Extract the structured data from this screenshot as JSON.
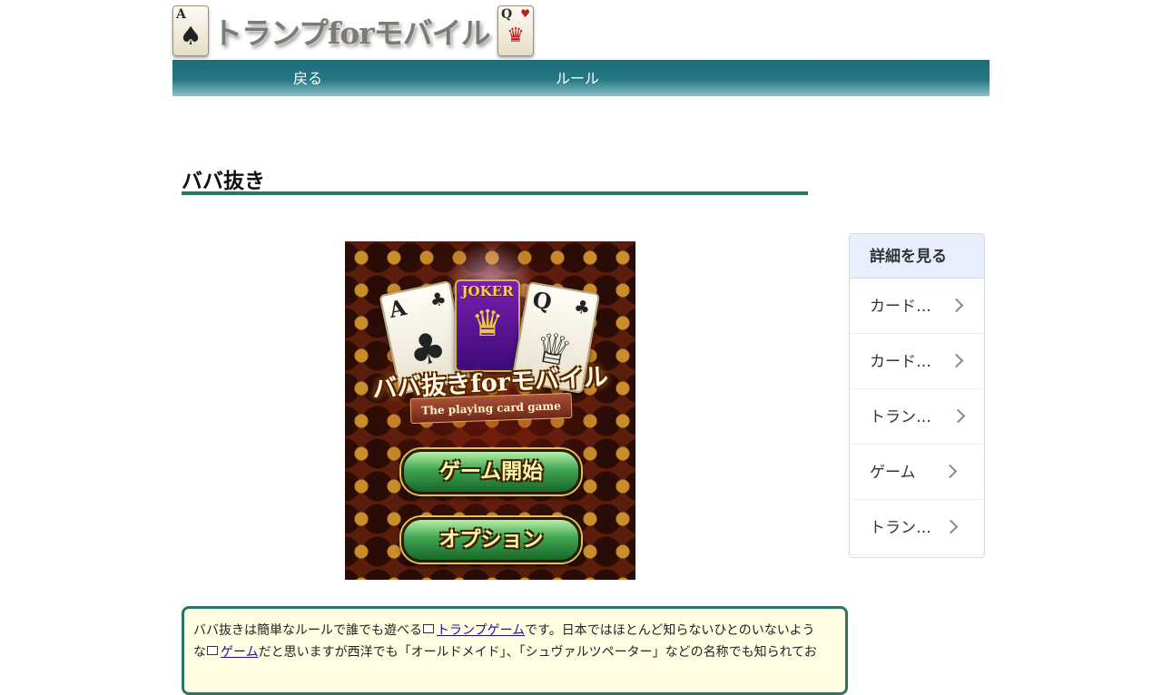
{
  "header": {
    "logo_text": "トランプforモバイル",
    "logo_left_card": {
      "rank": "A",
      "suit": "♠"
    },
    "logo_right_card": {
      "rank": "Q",
      "suit": "♥"
    }
  },
  "nav": {
    "back_label": "戻る",
    "rule_label": "ルール"
  },
  "page": {
    "title": "ババ抜き"
  },
  "game_art": {
    "card_left": {
      "rank": "A",
      "suit": "♣"
    },
    "joker_label": "JOKER",
    "card_right": {
      "rank": "Q",
      "suit": "♣"
    },
    "logo": "ババ抜きforモバイル",
    "ribbon": "The playing card game",
    "start_button": "ゲーム開始",
    "option_button": "オプション"
  },
  "sidebar": {
    "heading": "詳細を見る",
    "items": [
      {
        "label": "カード…"
      },
      {
        "label": "カード …"
      },
      {
        "label": "トラン…"
      },
      {
        "label": "ゲーム"
      },
      {
        "label": "トラン…"
      }
    ]
  },
  "description": {
    "line1_before": "ババ抜きは簡単なルールで誰でも遊べる",
    "link1": "トランプゲーム",
    "line1_after": "です。日本ではほとんど知らないひとのいないよう",
    "line2_before": "な",
    "link2": "ゲーム",
    "line2_after": "だと思いますが西洋でも「オールドメイド」、「シュヴァルツペーター」などの名称でも知られてお"
  },
  "colors": {
    "nav_bg": "#247884",
    "title_rule": "#2b7565",
    "desc_border": "#2b7565",
    "desc_bg": "#fffde2",
    "sidebar_head_bg": "#e8eefb"
  }
}
